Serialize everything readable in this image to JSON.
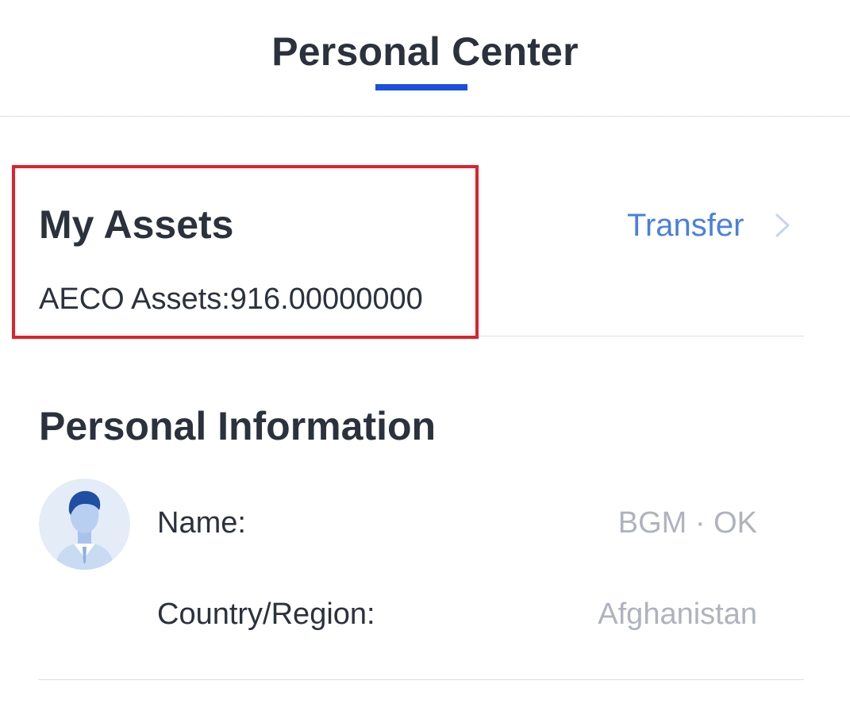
{
  "header": {
    "title": "Personal Center"
  },
  "assets": {
    "title": "My Assets",
    "value_text": "AECO Assets:916.00000000",
    "transfer_label": "Transfer"
  },
  "personal_info": {
    "title": "Personal Information",
    "avatar_icon": "user-avatar-icon",
    "rows": [
      {
        "label": "Name:",
        "value": "BGM · OK"
      },
      {
        "label": "Country/Region:",
        "value": "Afghanistan"
      }
    ]
  },
  "colors": {
    "accent_underline": "#1a4fe0",
    "link": "#4a7fe0",
    "highlight_border": "#e0212b",
    "text_primary": "#2b323d",
    "text_muted": "#aeb3be"
  }
}
